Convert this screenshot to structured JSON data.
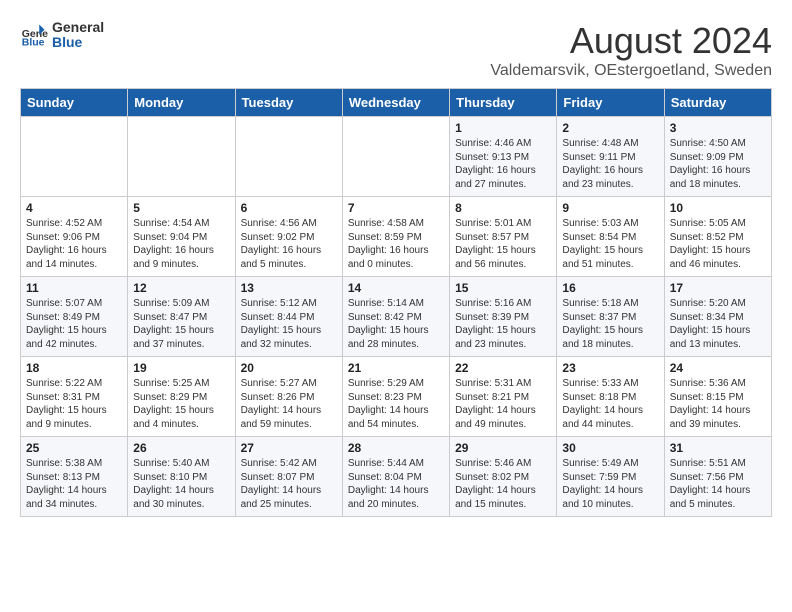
{
  "logo": {
    "general": "General",
    "blue": "Blue"
  },
  "title": "August 2024",
  "subtitle": "Valdemarsvik, OEstergoetland, Sweden",
  "headers": [
    "Sunday",
    "Monday",
    "Tuesday",
    "Wednesday",
    "Thursday",
    "Friday",
    "Saturday"
  ],
  "weeks": [
    [
      {
        "day": "",
        "sunrise": "",
        "sunset": "",
        "daylight": ""
      },
      {
        "day": "",
        "sunrise": "",
        "sunset": "",
        "daylight": ""
      },
      {
        "day": "",
        "sunrise": "",
        "sunset": "",
        "daylight": ""
      },
      {
        "day": "",
        "sunrise": "",
        "sunset": "",
        "daylight": ""
      },
      {
        "day": "1",
        "sunrise": "4:46 AM",
        "sunset": "9:13 PM",
        "daylight": "16 hours and 27 minutes."
      },
      {
        "day": "2",
        "sunrise": "4:48 AM",
        "sunset": "9:11 PM",
        "daylight": "16 hours and 23 minutes."
      },
      {
        "day": "3",
        "sunrise": "4:50 AM",
        "sunset": "9:09 PM",
        "daylight": "16 hours and 18 minutes."
      }
    ],
    [
      {
        "day": "4",
        "sunrise": "4:52 AM",
        "sunset": "9:06 PM",
        "daylight": "16 hours and 14 minutes."
      },
      {
        "day": "5",
        "sunrise": "4:54 AM",
        "sunset": "9:04 PM",
        "daylight": "16 hours and 9 minutes."
      },
      {
        "day": "6",
        "sunrise": "4:56 AM",
        "sunset": "9:02 PM",
        "daylight": "16 hours and 5 minutes."
      },
      {
        "day": "7",
        "sunrise": "4:58 AM",
        "sunset": "8:59 PM",
        "daylight": "16 hours and 0 minutes."
      },
      {
        "day": "8",
        "sunrise": "5:01 AM",
        "sunset": "8:57 PM",
        "daylight": "15 hours and 56 minutes."
      },
      {
        "day": "9",
        "sunrise": "5:03 AM",
        "sunset": "8:54 PM",
        "daylight": "15 hours and 51 minutes."
      },
      {
        "day": "10",
        "sunrise": "5:05 AM",
        "sunset": "8:52 PM",
        "daylight": "15 hours and 46 minutes."
      }
    ],
    [
      {
        "day": "11",
        "sunrise": "5:07 AM",
        "sunset": "8:49 PM",
        "daylight": "15 hours and 42 minutes."
      },
      {
        "day": "12",
        "sunrise": "5:09 AM",
        "sunset": "8:47 PM",
        "daylight": "15 hours and 37 minutes."
      },
      {
        "day": "13",
        "sunrise": "5:12 AM",
        "sunset": "8:44 PM",
        "daylight": "15 hours and 32 minutes."
      },
      {
        "day": "14",
        "sunrise": "5:14 AM",
        "sunset": "8:42 PM",
        "daylight": "15 hours and 28 minutes."
      },
      {
        "day": "15",
        "sunrise": "5:16 AM",
        "sunset": "8:39 PM",
        "daylight": "15 hours and 23 minutes."
      },
      {
        "day": "16",
        "sunrise": "5:18 AM",
        "sunset": "8:37 PM",
        "daylight": "15 hours and 18 minutes."
      },
      {
        "day": "17",
        "sunrise": "5:20 AM",
        "sunset": "8:34 PM",
        "daylight": "15 hours and 13 minutes."
      }
    ],
    [
      {
        "day": "18",
        "sunrise": "5:22 AM",
        "sunset": "8:31 PM",
        "daylight": "15 hours and 9 minutes."
      },
      {
        "day": "19",
        "sunrise": "5:25 AM",
        "sunset": "8:29 PM",
        "daylight": "15 hours and 4 minutes."
      },
      {
        "day": "20",
        "sunrise": "5:27 AM",
        "sunset": "8:26 PM",
        "daylight": "14 hours and 59 minutes."
      },
      {
        "day": "21",
        "sunrise": "5:29 AM",
        "sunset": "8:23 PM",
        "daylight": "14 hours and 54 minutes."
      },
      {
        "day": "22",
        "sunrise": "5:31 AM",
        "sunset": "8:21 PM",
        "daylight": "14 hours and 49 minutes."
      },
      {
        "day": "23",
        "sunrise": "5:33 AM",
        "sunset": "8:18 PM",
        "daylight": "14 hours and 44 minutes."
      },
      {
        "day": "24",
        "sunrise": "5:36 AM",
        "sunset": "8:15 PM",
        "daylight": "14 hours and 39 minutes."
      }
    ],
    [
      {
        "day": "25",
        "sunrise": "5:38 AM",
        "sunset": "8:13 PM",
        "daylight": "14 hours and 34 minutes."
      },
      {
        "day": "26",
        "sunrise": "5:40 AM",
        "sunset": "8:10 PM",
        "daylight": "14 hours and 30 minutes."
      },
      {
        "day": "27",
        "sunrise": "5:42 AM",
        "sunset": "8:07 PM",
        "daylight": "14 hours and 25 minutes."
      },
      {
        "day": "28",
        "sunrise": "5:44 AM",
        "sunset": "8:04 PM",
        "daylight": "14 hours and 20 minutes."
      },
      {
        "day": "29",
        "sunrise": "5:46 AM",
        "sunset": "8:02 PM",
        "daylight": "14 hours and 15 minutes."
      },
      {
        "day": "30",
        "sunrise": "5:49 AM",
        "sunset": "7:59 PM",
        "daylight": "14 hours and 10 minutes."
      },
      {
        "day": "31",
        "sunrise": "5:51 AM",
        "sunset": "7:56 PM",
        "daylight": "14 hours and 5 minutes."
      }
    ]
  ]
}
